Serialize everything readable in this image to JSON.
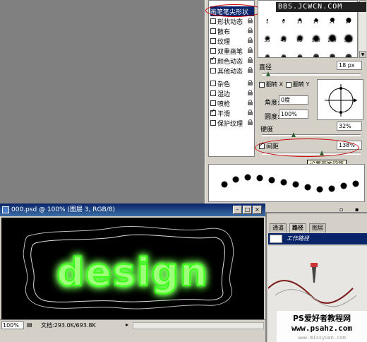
{
  "brushes_panel": {
    "categories": [
      {
        "label": "画笔笔尖形状",
        "checked": false,
        "selected": true,
        "lock": false
      },
      {
        "label": "形状动态",
        "checked": false,
        "selected": false,
        "lock": true
      },
      {
        "label": "散布",
        "checked": false,
        "selected": false,
        "lock": true
      },
      {
        "label": "纹理",
        "checked": false,
        "selected": false,
        "lock": true
      },
      {
        "label": "双重画笔",
        "checked": false,
        "selected": false,
        "lock": true
      },
      {
        "label": "颜色动态",
        "checked": true,
        "selected": false,
        "lock": true
      },
      {
        "label": "其他动态",
        "checked": false,
        "selected": false,
        "lock": true
      },
      {
        "label": "杂色",
        "checked": false,
        "selected": false,
        "lock": true
      },
      {
        "label": "湿边",
        "checked": false,
        "selected": false,
        "lock": true
      },
      {
        "label": "喷枪",
        "checked": false,
        "selected": false,
        "lock": true
      },
      {
        "label": "平滑",
        "checked": true,
        "selected": false,
        "lock": true
      },
      {
        "label": "保护纹理",
        "checked": false,
        "selected": false,
        "lock": true
      }
    ],
    "brush_tips": [
      "1",
      "9",
      "13",
      "17",
      "21",
      "27",
      "35",
      "45",
      "65",
      "100",
      "200",
      "300",
      "14",
      "24",
      "27",
      "39",
      "46",
      "59"
    ],
    "watermark_top": "BBS.JCWCN.COM",
    "diameter_label": "直径",
    "diameter_value": "18 px",
    "flip_x_label": "翻转 X",
    "flip_y_label": "翻转 Y",
    "angle_label": "角度:",
    "angle_value": "0度",
    "roundness_label": "圆度:",
    "roundness_value": "100%",
    "hardness_label": "硬度",
    "hardness_value": "32%",
    "spacing_label": "间距",
    "spacing_value": "138%",
    "tooltip": "设置画笔间距"
  },
  "document": {
    "title": "000.psd @ 100% (图层 3, RGB/8)",
    "canvas_text": "design",
    "zoom": "100%",
    "doc_size": "文档:293.0K/693.8K"
  },
  "paths_panel": {
    "tabs": [
      "通道",
      "路径",
      "图层"
    ],
    "path_name": "工作路径"
  },
  "watermark_bottom": {
    "line1": "PS爱好者教程网",
    "line2": "www.psahz.com",
    "line3": "www.missyuan.com"
  },
  "colors": {
    "glow_green": "#39ff14",
    "selection_blue": "#0a246a",
    "annotation_red": "#cc0000"
  }
}
